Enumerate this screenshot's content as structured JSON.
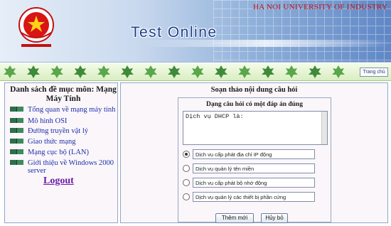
{
  "header": {
    "university": "HA NOI UNIVERSITY OF INDUSTRY",
    "app_title": "Test Online",
    "home_button": "Trang chủ",
    "colors": {
      "banner_start": "#e6eef8",
      "banner_end": "#5f87c6",
      "title": "#1a3f8a",
      "university": "#c41010",
      "leaf_bg": "#d9eec2"
    }
  },
  "sidebar": {
    "title": "Danh sách đề mục môn: Mạng Máy Tính",
    "topics": [
      {
        "label": "Tổng quan về mạng máy tính",
        "icon": "book-icon"
      },
      {
        "label": "Mô hình OSI",
        "icon": "book-icon"
      },
      {
        "label": "Đường truyền vật lý",
        "icon": "book-icon"
      },
      {
        "label": "Giao thức mạng",
        "icon": "book-icon"
      },
      {
        "label": "Mạng cục bộ (LAN)",
        "icon": "book-icon"
      },
      {
        "label": "Giới thiệu về Windows 2000 server",
        "icon": "book-icon"
      }
    ],
    "logout_label": "Logout",
    "link_color": "#1b2fa8",
    "logout_color": "#6a1aa6"
  },
  "editor": {
    "title": "Soạn thảo nội dung câu hỏi",
    "question_type": "Dạng câu hỏi có một đáp án đúng",
    "question_text": "Dịch vụ DHCP là:",
    "answers": [
      {
        "text": "Dịch vụ cấp phát địa chỉ IP động",
        "selected": true
      },
      {
        "text": "Dịch vụ quản lý tên miền",
        "selected": false
      },
      {
        "text": "Dịch vụ cấp phát bộ nhớ động",
        "selected": false
      },
      {
        "text": "Dịch vụ quản lý các thiết bị phần cứng",
        "selected": false
      }
    ],
    "add_button": "Thêm mới",
    "cancel_button": "Hủy bỏ"
  }
}
